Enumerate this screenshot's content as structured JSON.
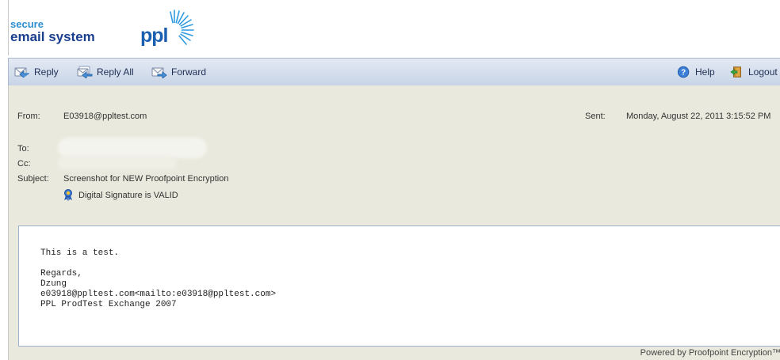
{
  "brand": {
    "line1": "secure",
    "line2": "email system",
    "logo_word": "ppl"
  },
  "toolbar": {
    "reply": {
      "label": "Reply",
      "icon": "reply-icon"
    },
    "reply_all": {
      "label": "Reply All",
      "icon": "reply-all-icon"
    },
    "forward": {
      "label": "Forward",
      "icon": "forward-icon"
    },
    "help": {
      "label": "Help",
      "icon": "help-icon"
    },
    "logout": {
      "label": "Logout",
      "icon": "logout-door-icon"
    }
  },
  "header": {
    "from_label": "From:",
    "from_value": "E03918@ppltest.com",
    "sent_label": "Sent:",
    "sent_value": "Monday, August 22, 2011 3:15:52 PM",
    "to_label": "To:",
    "cc_label": "Cc:",
    "subject_label": "Subject:",
    "subject_value": "Screenshot for NEW Proofpoint Encryption",
    "signature_text": "Digital Signature is VALID",
    "signature_icon": "ribbon-badge-icon"
  },
  "message": {
    "body": "This is a test.\n\nRegards,\nDzung\ne03918@ppltest.com<mailto:e03918@ppltest.com>\nPPL ProdTest Exchange 2007"
  },
  "footer": {
    "powered_by": "Powered by Proofpoint Encryption™"
  },
  "colors": {
    "toolbar_top": "#e3eaf4",
    "toolbar_bottom": "#c8d4e6",
    "header_panel": "#e9e9dd",
    "brand_blue": "#1a3f8f",
    "brand_light_blue": "#2f8fd0"
  }
}
